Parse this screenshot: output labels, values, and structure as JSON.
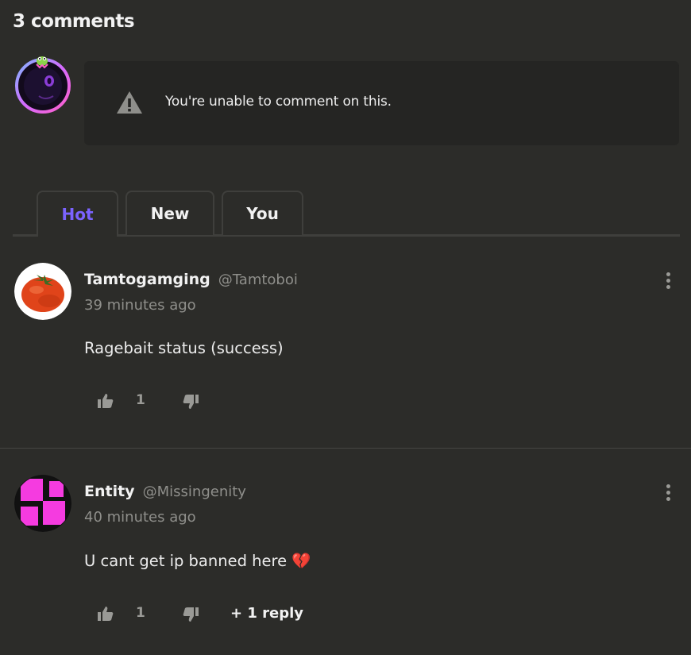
{
  "header": {
    "title": "3 comments"
  },
  "composer": {
    "avatar_icon": "purple-eye-orb-avatar",
    "notice_icon": "warning-triangle-icon",
    "notice_text": "You're unable to comment on this."
  },
  "tabs": [
    {
      "label": "Hot",
      "active": true
    },
    {
      "label": "New",
      "active": false
    },
    {
      "label": "You",
      "active": false
    }
  ],
  "colors": {
    "accent": "#7b63ff",
    "background": "#2c2c29",
    "panel": "#252523"
  },
  "comments": [
    {
      "author": "Tamtogamging",
      "handle": "@Tamtoboi",
      "time": "39 minutes ago",
      "text": "Ragebait status (success)",
      "likes": "1",
      "avatar_icon": "tomato-avatar"
    },
    {
      "author": "Entity",
      "handle": "@Missingenity",
      "time": "40 minutes ago",
      "text": "U cant get ip banned here 💔",
      "likes": "1",
      "reply_label": "+ 1 reply",
      "avatar_icon": "magenta-checker-avatar"
    }
  ]
}
